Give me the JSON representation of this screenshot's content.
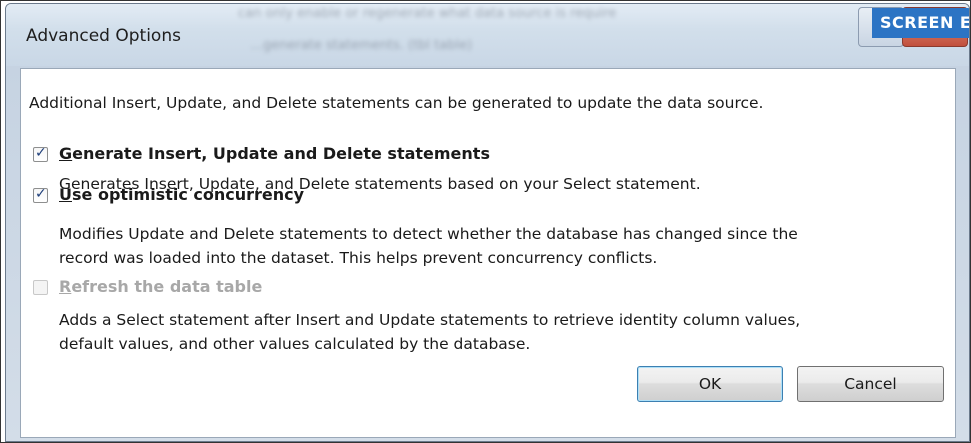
{
  "window": {
    "title": "Advanced Options",
    "background_text_1": "can only enable or regenerate what data source is require",
    "background_text_2": "…generate statements. (tbl table)"
  },
  "watermark": {
    "label": "SCREEN E"
  },
  "intro_text": "Additional  Insert, Update, and Delete statements can be generated to update the data source.",
  "options": [
    {
      "label_first": "G",
      "label_rest": "enerate Insert, Update and Delete statements",
      "checked": true,
      "enabled": true,
      "description_lines": [
        "Generates Insert, Update, and Delete statements based on your Select statement."
      ]
    },
    {
      "label_first": "U",
      "label_rest": "se optimistic concurrency",
      "checked": true,
      "enabled": true,
      "description_lines": [
        "Modifies Update and Delete statements to detect whether the database has changed since the",
        "record was loaded into the dataset. This helps prevent concurrency conflicts."
      ]
    },
    {
      "label_first": "R",
      "label_rest": "efresh the data table",
      "checked": false,
      "enabled": false,
      "description_lines": [
        "Adds a Select statement after Insert and Update statements to retrieve identity column values,",
        "default values, and other values calculated by the database."
      ]
    }
  ],
  "buttons": {
    "ok": "OK",
    "cancel": "Cancel"
  },
  "colors": {
    "title_bar": "#cfdbe9",
    "close_button": "#c2503c",
    "watermark": "#2c74c4",
    "default_button_border": "#3c7fb1"
  }
}
